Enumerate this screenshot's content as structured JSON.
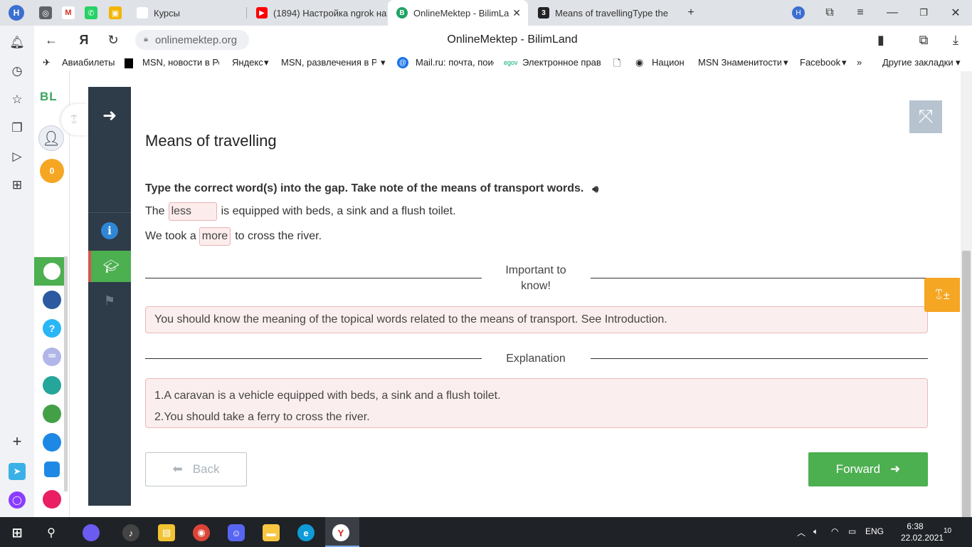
{
  "browser": {
    "profile_letter": "H",
    "tabs": [
      {
        "label": "Курсы",
        "icon": "classroom-icon"
      },
      {
        "label": "(1894) Настройка ngrok на",
        "icon": "youtube-icon"
      },
      {
        "label": "OnlineMektep - BilimLa",
        "icon": "bilimland-icon",
        "active": true
      },
      {
        "label": "Means of travellingType the",
        "icon": "quiz-icon"
      }
    ],
    "new_tab_symbol": "+",
    "url": "onlinemektep.org",
    "page_title": "OnlineMektep - BilimLand",
    "bookmarks": [
      "Авиабилеты",
      "MSN, новости в Ро",
      "Яндекс",
      "MSN, развлечения в Р",
      "Mail.ru: почта, поис",
      "Электронное прав",
      "Национ",
      "MSN Знаменитости",
      "Facebook",
      "Другие закладки"
    ]
  },
  "site": {
    "logo": "BL",
    "score": "0",
    "apps": [
      "Digital Class",
      "Smart Nation",
      "?",
      "Keyboard",
      "Bilim Online",
      "Bilim Land",
      "Bilim Book",
      "Bilim Stat",
      "Twig"
    ]
  },
  "lesson": {
    "title": "Means of travelling",
    "instruction": "Type the correct word(s) into the gap. Take note of the means of transport words.",
    "sentences": [
      {
        "before": "The",
        "gap": "less",
        "after": "is equipped with beds, a sink and a flush toilet."
      },
      {
        "before": "We took a",
        "gap": "more",
        "after": "to cross the river."
      }
    ],
    "important_title": "Important to know!",
    "important_text": "You should know the meaning of the topical words related to the means of transport. See Introduction.",
    "explanation_title": "Explanation",
    "explanation_lines": [
      "1.A caravan is a vehicle equipped with beds, a sink and a flush toilet.",
      "2.You should take a ferry to cross the river."
    ],
    "back_label": "Back",
    "forward_label": "Forward"
  },
  "colors": {
    "accent": "#4caf50",
    "panel": "#2e3b48",
    "alert_bg": "#fbeeee",
    "orange": "#f5a623"
  },
  "taskbar": {
    "language": "ENG",
    "time": "6:38",
    "date": "22.02.2021",
    "notifications": "10"
  }
}
